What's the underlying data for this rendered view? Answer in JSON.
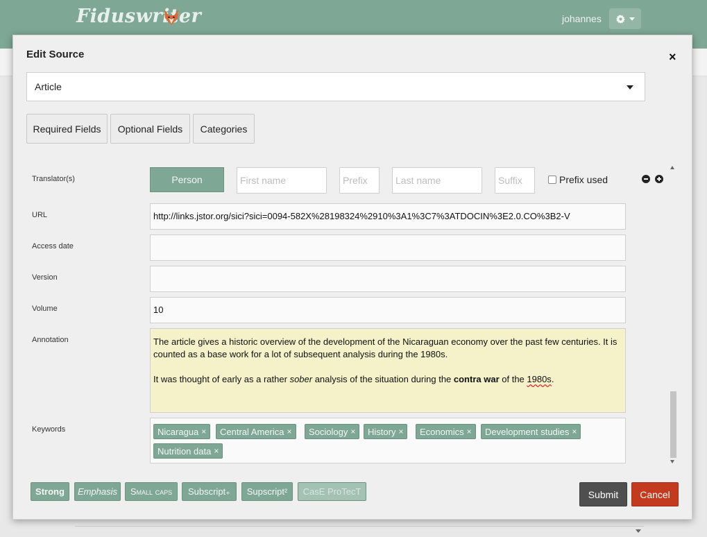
{
  "app": {
    "logo_text": "Fiduswriter",
    "username": "johannes",
    "brand_color": "#7fa796"
  },
  "dialog": {
    "title": "Edit Source",
    "close_glyph": "×",
    "source_type": "Article",
    "tabs": [
      {
        "label": "Required Fields"
      },
      {
        "label": "Optional Fields"
      },
      {
        "label": "Categories"
      }
    ]
  },
  "fields": {
    "translator": {
      "label": "Translator(s)",
      "person_button": "Person",
      "first_name_placeholder": "First name",
      "prefix_placeholder": "Prefix",
      "last_name_placeholder": "Last name",
      "suffix_placeholder": "Suffix",
      "prefix_used_label": "Prefix used",
      "prefix_used_checked": false
    },
    "url": {
      "label": "URL",
      "value": "http://links.jstor.org/sici?sici=0094-582X%28198324%2910%3A1%3C7%3ATDOCIN%3E2.0.CO%3B2-V"
    },
    "access_date": {
      "label": "Access date",
      "value": ""
    },
    "version": {
      "label": "Version",
      "value": ""
    },
    "volume": {
      "label": "Volume",
      "value": "10"
    },
    "annotation": {
      "label": "Annotation",
      "para1": "The article gives a historic overview of the development of the Nicaraguan economy over the past few centuries. It is counted as a base work for a lot of subsequent analysis during the 1980s.",
      "para2_a": "It was thought of early as a rather ",
      "para2_emph": "sober",
      "para2_b": " analysis of the situation during the ",
      "para2_strong": "contra war",
      "para2_c": " of the ",
      "para2_misspelled": "1980s",
      "para2_d": ".",
      "background_color": "#f5f1c8"
    },
    "keywords": {
      "label": "Keywords",
      "remove_glyph": "×",
      "items": [
        "Nicaragua",
        "Central America",
        "Sociology",
        "History",
        "Economics",
        "Development studies",
        "Nutrition data"
      ]
    }
  },
  "formatting": {
    "strong": "Strong",
    "emphasis": "Emphasis",
    "small_caps": "Small caps",
    "subscript": "Subscript₊",
    "supscript": "Supscript²",
    "case_protect": "CasE ProTecT"
  },
  "actions": {
    "submit": "Submit",
    "cancel": "Cancel",
    "cancel_color": "#c33a1f"
  }
}
